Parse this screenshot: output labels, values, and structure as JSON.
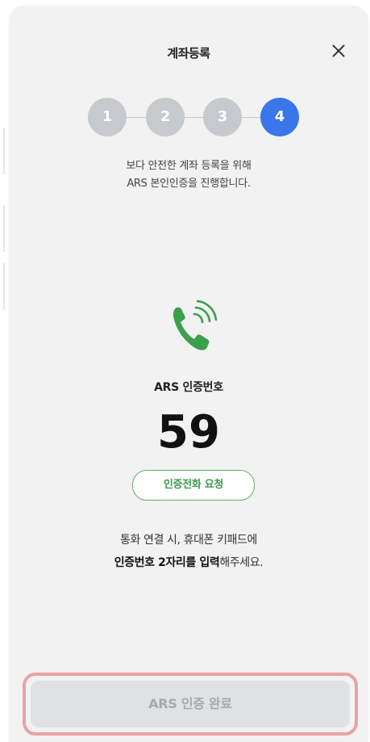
{
  "header": {
    "title": "계좌등록",
    "close_icon": "close-icon"
  },
  "stepper": {
    "steps": [
      "1",
      "2",
      "3",
      "4"
    ],
    "current_step": 4,
    "inactive_color": "#c6c9cd",
    "active_color": "#3a76e9"
  },
  "description": {
    "line1": "보다 안전한 계좌 등록을 위해",
    "line2": "ARS 본인인증을 진행합니다."
  },
  "ars": {
    "icon": "phone-ringing-icon",
    "icon_color": "#3b9f4c",
    "label": "ARS 인증번호",
    "code": "59",
    "request_button": "인증전화 요청",
    "request_color": "#5aaf67"
  },
  "guide": {
    "line1": "통화 연결 시, 휴대폰 키패드에",
    "line2_bold": "인증번호 2자리를 입력",
    "line2_rest": "해주세요."
  },
  "footer": {
    "complete_button": "ARS 인증 완료",
    "highlight_color": "#e9a3a8"
  }
}
